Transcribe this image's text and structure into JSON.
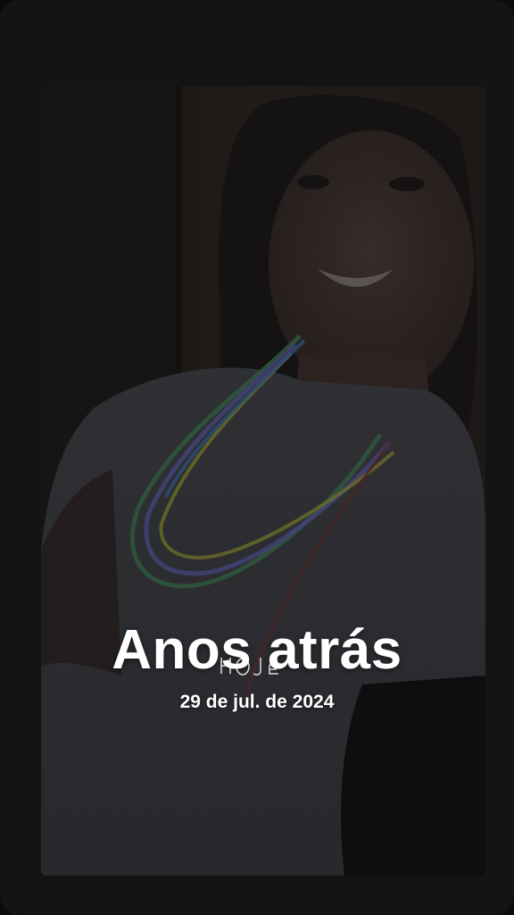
{
  "memory": {
    "title": "Anos atrás",
    "date": "29 de jul. de 2024",
    "photo_description_icon": "memory-photo"
  },
  "colors": {
    "background": "#141415",
    "text": "#ffffff"
  }
}
